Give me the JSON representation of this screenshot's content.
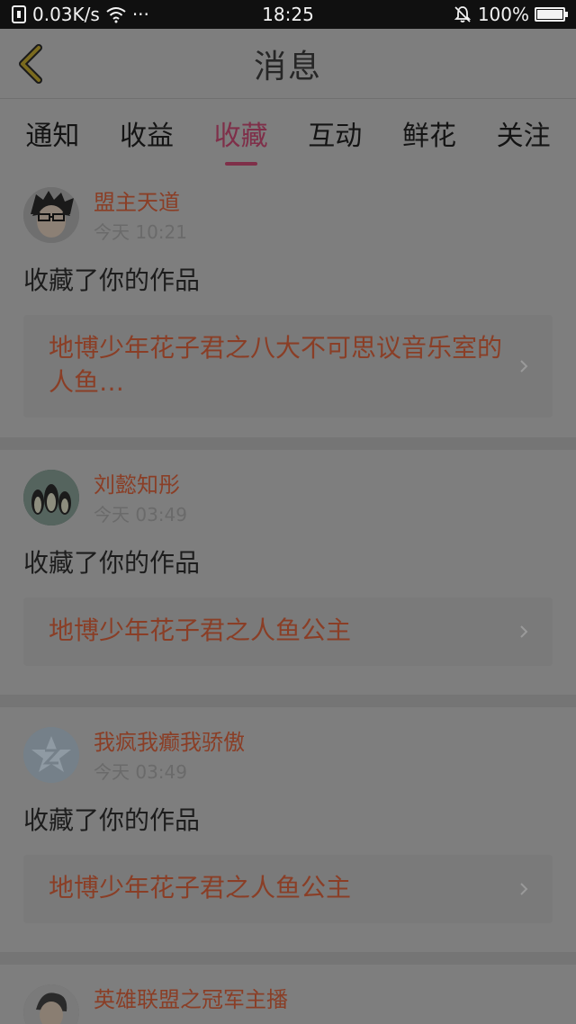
{
  "status_bar": {
    "speed": "0.03K/s",
    "dots": "···",
    "time": "18:25",
    "battery": "100%"
  },
  "header": {
    "title": "消息",
    "back_icon": "chevron-left-icon"
  },
  "tabs": [
    {
      "label": "通知",
      "active": false
    },
    {
      "label": "收益",
      "active": false
    },
    {
      "label": "收藏",
      "active": true
    },
    {
      "label": "互动",
      "active": false
    },
    {
      "label": "鲜花",
      "active": false
    },
    {
      "label": "关注",
      "active": false
    }
  ],
  "items": [
    {
      "name": "盟主天道",
      "time": "今天 10:21",
      "action": "收藏了你的作品",
      "work": "地博少年花子君之八大不可思议音乐室的人鱼…"
    },
    {
      "name": "刘懿知彤",
      "time": "今天 03:49",
      "action": "收藏了你的作品",
      "work": "地博少年花子君之人鱼公主"
    },
    {
      "name": "我疯我癫我骄傲",
      "time": "今天 03:49",
      "action": "收藏了你的作品",
      "work": "地博少年花子君之人鱼公主"
    },
    {
      "name": "英雄联盟之冠军主播"
    }
  ],
  "colors": {
    "accent": "#7f2f49",
    "name": "#8a3e26",
    "background": "#7e7e7e"
  }
}
